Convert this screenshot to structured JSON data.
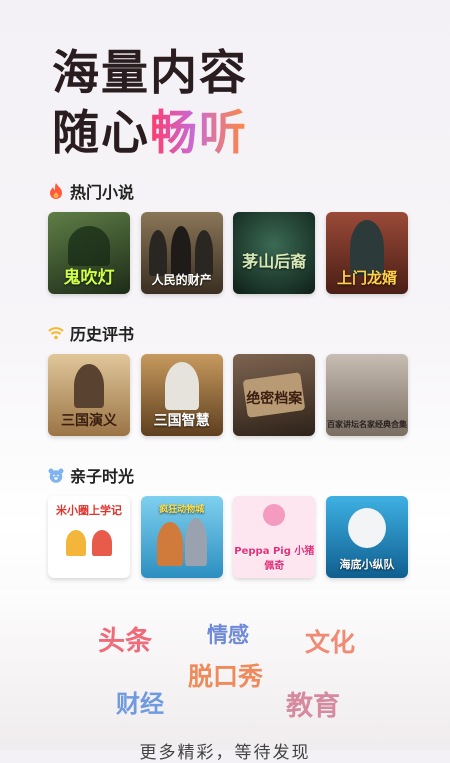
{
  "headline": {
    "line1": "海量内容",
    "line2_a": "随心",
    "line2_b": "畅听"
  },
  "sections": [
    {
      "title": "热门小说",
      "icon": "fire-icon",
      "covers": [
        {
          "title": "鬼吹灯",
          "bg": "#2f4a2c"
        },
        {
          "title": "人民的财产",
          "bg": "#6b5638"
        },
        {
          "title": "茅山后裔",
          "bg": "#1f3a30"
        },
        {
          "title": "上门龙婿",
          "bg": "#6a2c24"
        }
      ]
    },
    {
      "title": "历史评书",
      "icon": "radio-signal-icon",
      "covers": [
        {
          "title": "三国演义",
          "bg": "#caa56f"
        },
        {
          "title": "三国智慧",
          "bg": "#8a6437"
        },
        {
          "title": "绝密档案",
          "bg": "#4e3a2c"
        },
        {
          "title": "百家讲坛名家经典合集",
          "bg": "#a0938a"
        }
      ]
    },
    {
      "title": "亲子时光",
      "icon": "bear-face-icon",
      "covers": [
        {
          "title": "米小圈上学记",
          "bg": "#ffffff"
        },
        {
          "title": "疯狂动物城",
          "bg": "#4db2d8"
        },
        {
          "title": "Peppa Pig 小猪佩奇",
          "bg": "#fde6ef"
        },
        {
          "title": "海底小纵队",
          "bg": "#1d86bf"
        }
      ]
    }
  ],
  "tags": [
    {
      "text": "头条",
      "color": "#f06b7a"
    },
    {
      "text": "情感",
      "color": "#6f8ad8"
    },
    {
      "text": "文化",
      "color": "#f08a72"
    },
    {
      "text": "脱口秀",
      "color": "#f08a5a"
    },
    {
      "text": "财经",
      "color": "#6f9adf"
    },
    {
      "text": "教育",
      "color": "#d68aa0"
    }
  ],
  "footer": "更多精彩，等待发现"
}
